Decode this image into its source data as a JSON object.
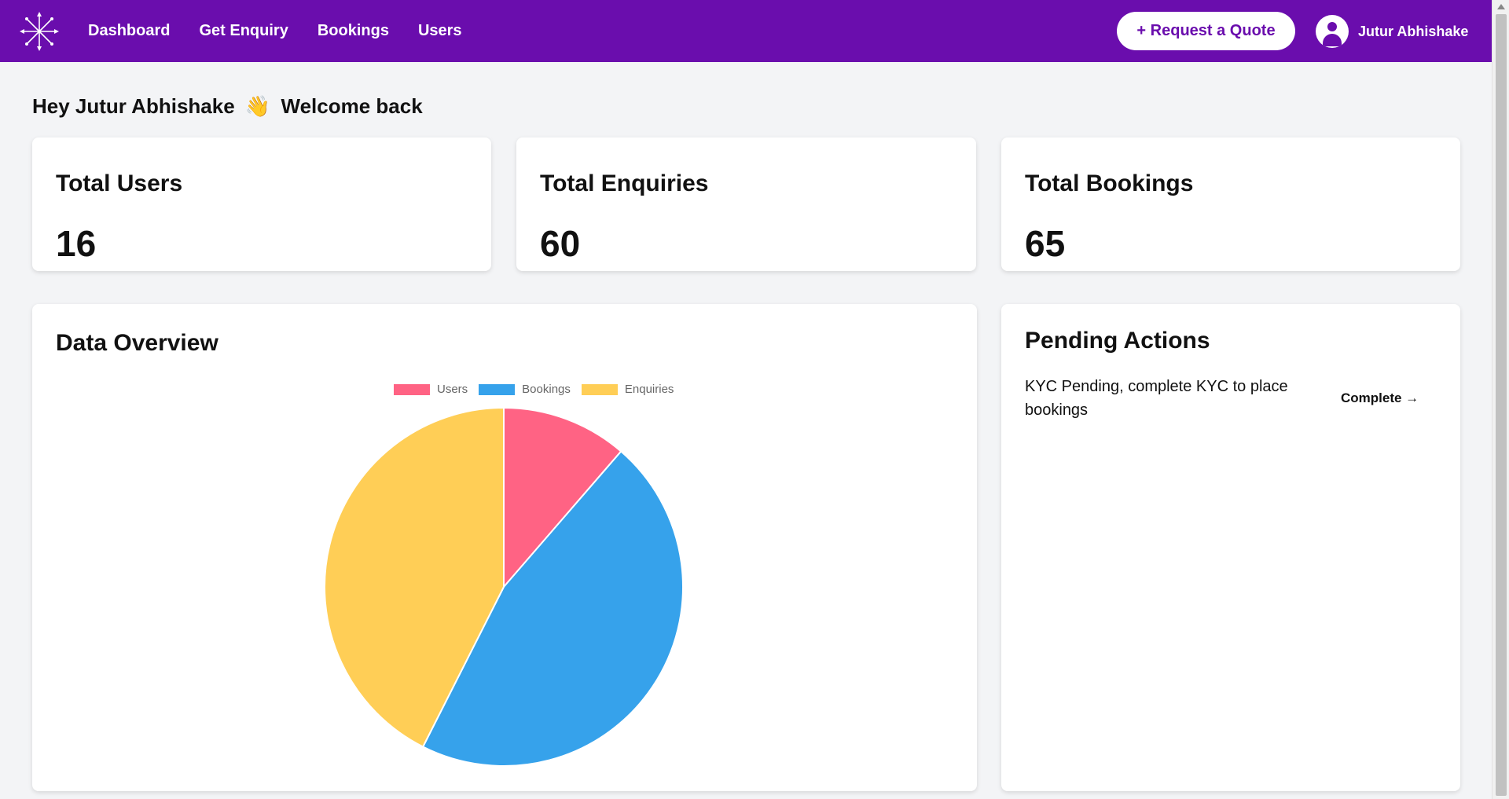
{
  "navbar": {
    "bg_color": "#6a0dad",
    "logo_icon": "compass-arrows-logo-icon",
    "links": [
      "Dashboard",
      "Get Enquiry",
      "Bookings",
      "Users"
    ],
    "quote_button": "+ Request a Quote",
    "user_name": "Jutur Abhishake"
  },
  "greeting": {
    "text": "Hey Jutur Abhishake",
    "emoji": "👋",
    "suffix": "Welcome back"
  },
  "stats": [
    {
      "title": "Total Users",
      "value": "16"
    },
    {
      "title": "Total Enquiries",
      "value": "60"
    },
    {
      "title": "Total Bookings",
      "value": "65"
    }
  ],
  "overview": {
    "title": "Data Overview"
  },
  "chart_data": {
    "type": "pie",
    "categories": [
      "Users",
      "Bookings",
      "Enquiries"
    ],
    "values": [
      16,
      65,
      60
    ],
    "colors": [
      "#ff6384",
      "#36a2eb",
      "#ffce56"
    ],
    "legend": "top"
  },
  "pending": {
    "title": "Pending Actions",
    "items": [
      {
        "text": "KYC Pending, complete KYC to place bookings",
        "action": "Complete →"
      }
    ]
  }
}
